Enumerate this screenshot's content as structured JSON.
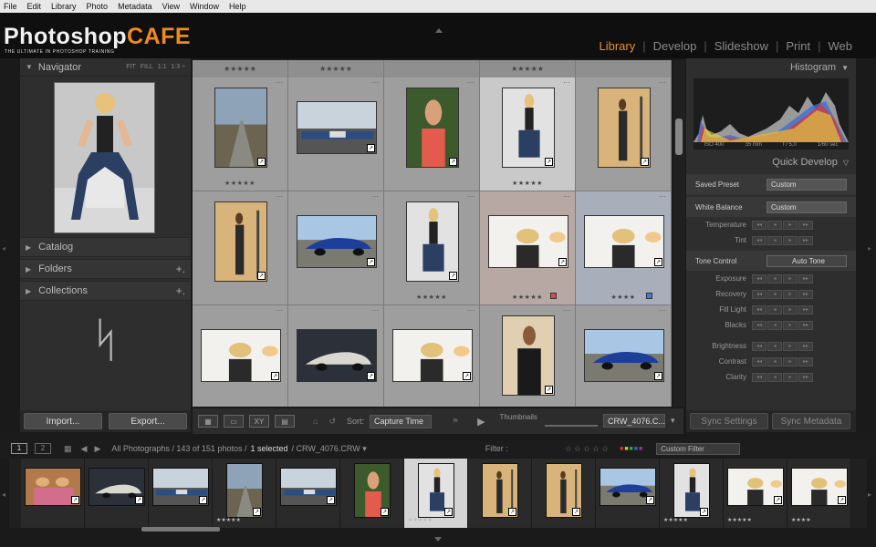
{
  "menu": [
    "File",
    "Edit",
    "Library",
    "Photo",
    "Metadata",
    "View",
    "Window",
    "Help"
  ],
  "logo": {
    "part1": "Photoshop",
    "part2": "CAFE",
    "tagline": "THE ULTIMATE IN PHOTOSHOP TRAINING"
  },
  "modules": [
    "Library",
    "Develop",
    "Slideshow",
    "Print",
    "Web"
  ],
  "active_module": "Library",
  "navigator": {
    "title": "Navigator",
    "fit": "FIT",
    "fill": "FILL",
    "one": "1:1",
    "ratio": "1:3 ÷"
  },
  "left_panels": [
    {
      "label": "Catalog",
      "plus": ""
    },
    {
      "label": "Folders",
      "plus": "+."
    },
    {
      "label": "Collections",
      "plus": "+."
    }
  ],
  "import_label": "Import...",
  "export_label": "Export...",
  "grid_top_stars": [
    "★★★★★",
    "★★★★★",
    "",
    "★★★★★",
    ""
  ],
  "grid": [
    [
      {
        "style": "road",
        "stars": "★★★★★",
        "w": 58,
        "h": 88,
        "state": ""
      },
      {
        "style": "cars",
        "stars": "",
        "w": 88,
        "h": 58,
        "state": ""
      },
      {
        "style": "woman",
        "stars": "",
        "w": 58,
        "h": 88,
        "state": ""
      },
      {
        "style": "sit",
        "stars": "★★★★★",
        "w": 58,
        "h": 88,
        "state": "sel"
      },
      {
        "style": "man",
        "stars": "",
        "w": 58,
        "h": 88,
        "state": ""
      }
    ],
    [
      {
        "style": "man",
        "stars": "",
        "w": 58,
        "h": 88,
        "state": ""
      },
      {
        "style": "bluecar",
        "stars": "",
        "w": 88,
        "h": 58,
        "state": ""
      },
      {
        "style": "sit",
        "stars": "★★★★★",
        "w": 58,
        "h": 88,
        "state": ""
      },
      {
        "style": "blonde",
        "stars": "★★★★★",
        "w": 88,
        "h": 58,
        "state": "tr"
      },
      {
        "style": "blonde",
        "stars": "★★★★",
        "w": 88,
        "h": 58,
        "state": "tb"
      }
    ],
    [
      {
        "style": "blonde",
        "stars": "",
        "w": 88,
        "h": 58,
        "state": ""
      },
      {
        "style": "darkcar",
        "stars": "",
        "w": 88,
        "h": 58,
        "state": ""
      },
      {
        "style": "blonde",
        "stars": "",
        "w": 88,
        "h": 58,
        "state": ""
      },
      {
        "style": "leather",
        "stars": "",
        "w": 58,
        "h": 88,
        "state": ""
      },
      {
        "style": "bluecar",
        "stars": "",
        "w": 88,
        "h": 58,
        "state": ""
      }
    ]
  ],
  "toolbar": {
    "sort_label": "Sort:",
    "sort_value": "Capture Time",
    "thumbnails_label": "Thumbnails",
    "filename": "CRW_4076.C..."
  },
  "histogram": {
    "title": "Histogram",
    "iso": "ISO 400",
    "focal": "35 mm",
    "aperture": "f / 5,0",
    "shutter": "1/60 sec"
  },
  "quick_develop": {
    "title": "Quick Develop",
    "saved_preset_label": "Saved Preset",
    "saved_preset_value": "Custom",
    "wb_label": "White Balance",
    "wb_value": "Custom",
    "wb_adjust": [
      "Temperature",
      "Tint"
    ],
    "tone_label": "Tone Control",
    "auto_tone": "Auto Tone",
    "tone_adjust": [
      "Exposure",
      "Recovery",
      "Fill Light",
      "Blacks"
    ],
    "presence_adjust": [
      "Brightness",
      "Contrast",
      "Clarity"
    ]
  },
  "sync_settings": "Sync Settings",
  "sync_metadata": "Sync Metadata",
  "status": {
    "page1": "1",
    "page2": "2",
    "path": "All Photographs / 143 of 151 photos /",
    "selected": "1 selected",
    "file": "/ CRW_4076.CRW ▾",
    "filter_label": "Filter :",
    "custom_filter": "Custom Filter"
  },
  "filmstrip": [
    {
      "style": "group",
      "stars": ""
    },
    {
      "style": "darkcar",
      "stars": ""
    },
    {
      "style": "cars",
      "stars": ""
    },
    {
      "style": "road",
      "stars": "★★★★★"
    },
    {
      "style": "cars",
      "stars": ""
    },
    {
      "style": "woman",
      "stars": ""
    },
    {
      "style": "sit",
      "stars": "★★★★★"
    },
    {
      "style": "man",
      "stars": ""
    },
    {
      "style": "man",
      "stars": ""
    },
    {
      "style": "bluecar",
      "stars": ""
    },
    {
      "style": "sit",
      "stars": "★★★★★"
    },
    {
      "style": "blonde",
      "stars": "★★★★★"
    },
    {
      "style": "blonde",
      "stars": "★★★★"
    }
  ],
  "colors": {
    "accent": "#e8912a",
    "grid_bg": "#8f8f8f",
    "panel": "#2e2e2e"
  }
}
